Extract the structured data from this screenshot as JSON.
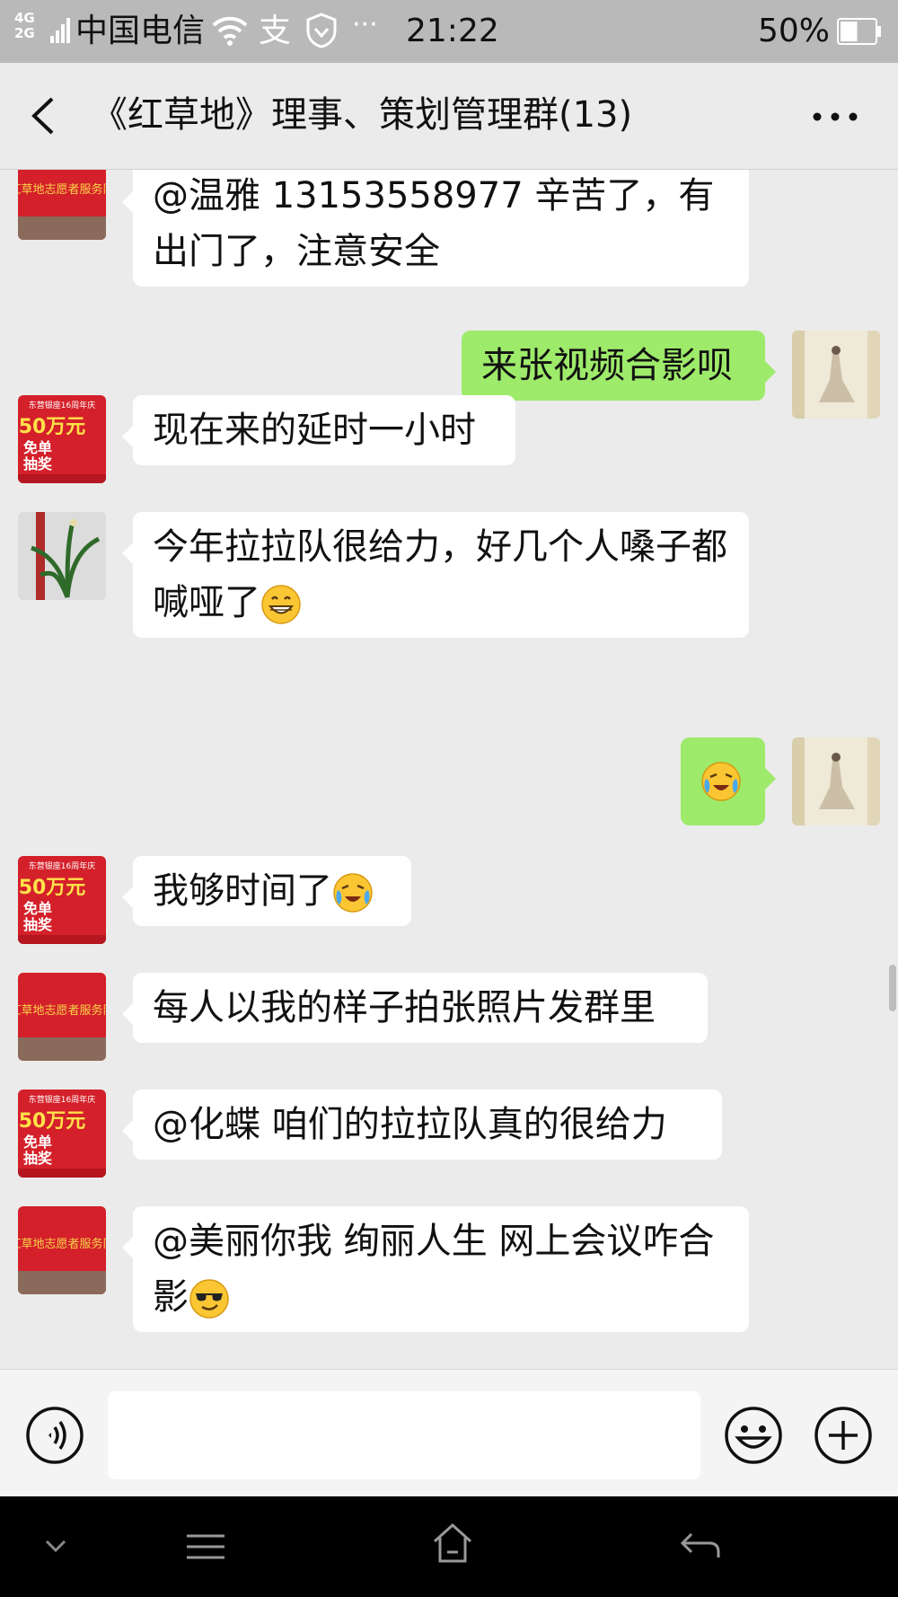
{
  "status_bar": {
    "network": [
      "4G",
      "2G"
    ],
    "carrier": "中国电信",
    "alipay_glyph": "支",
    "more_indicator": "···",
    "time": "21:22",
    "battery": "50%",
    "battery_level": 0.5
  },
  "header": {
    "title": "《红草地》理事、策划管理群(13)",
    "back_icon": "chevron-left-icon",
    "more_icon": "more-horizontal-icon"
  },
  "messages": [
    {
      "side": "left",
      "avatar": "banner-avatar",
      "text": "@温雅 13153558977  辛苦了，有出门了，注意安全"
    },
    {
      "side": "right",
      "avatar": "self-avatar",
      "text": "来张视频合影呗"
    },
    {
      "side": "left",
      "avatar": "poster-avatar",
      "text": "现在来的延时一小时",
      "poster_text": [
        "东营银座16周年庆",
        "50万元",
        "免单",
        "抽奖"
      ]
    },
    {
      "side": "left",
      "avatar": "plant-avatar",
      "text": "今年拉拉队很给力，好几个人嗓子都喊哑了",
      "emoji": "grin-emoji"
    },
    {
      "side": "right",
      "avatar": "self-avatar",
      "text": "",
      "emoji": "cry-laugh-emoji"
    },
    {
      "side": "left",
      "avatar": "poster-avatar",
      "text": "我够时间了",
      "emoji": "cry-laugh-emoji"
    },
    {
      "side": "left",
      "avatar": "banner-avatar",
      "text": "每人以我的样子拍张照片发群里"
    },
    {
      "side": "left",
      "avatar": "poster-avatar",
      "text": "@化蝶  咱们的拉拉队真的很给力"
    },
    {
      "side": "left",
      "avatar": "banner-avatar",
      "text": "@美丽你我 绚丽人生  网上会议咋合影",
      "emoji": "sunglasses-emoji"
    }
  ],
  "banner_text": "红草地志愿者服务队",
  "colors": {
    "green_bubble": "#9eea6a",
    "banner_red": "#d4202a",
    "background": "#ebebeb"
  },
  "input_bar": {
    "placeholder": "",
    "voice_icon": "voice-icon",
    "emoji_icon": "smiley-icon",
    "plus_icon": "plus-icon"
  },
  "nav_bar": {
    "icons": [
      "chevron-down-icon",
      "menu-icon",
      "home-icon",
      "back-icon"
    ]
  }
}
